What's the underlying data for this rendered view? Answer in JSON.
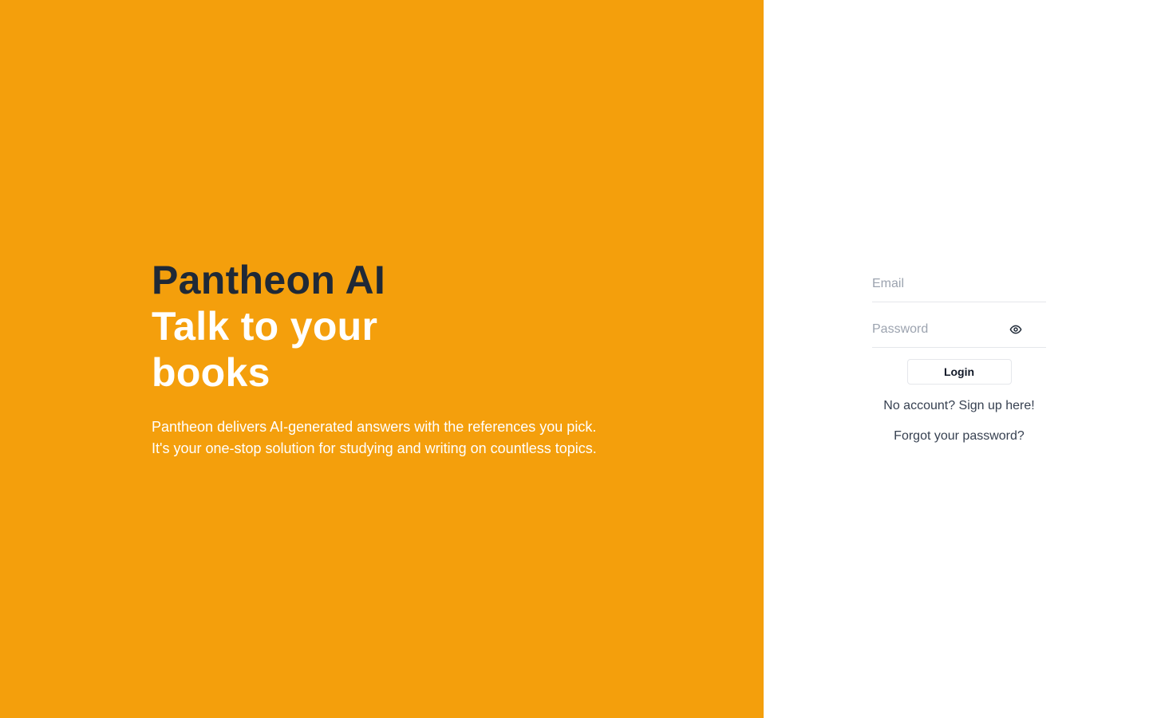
{
  "hero": {
    "brand": "Pantheon AI",
    "tagline": "Talk to your books",
    "description_lines": [
      "Pantheon delivers AI-generated answers with the references you pick.",
      "It's your one-stop solution for studying and writing on countless topics."
    ],
    "background_color": "#f49f0c"
  },
  "login_form": {
    "email_placeholder": "Email",
    "email_value": "",
    "password_placeholder": "Password",
    "password_value": "",
    "show_password_icon": "eye-icon",
    "login_label": "Login",
    "signup_link": "No account? Sign up here!",
    "forgot_link": "Forgot your password?"
  }
}
